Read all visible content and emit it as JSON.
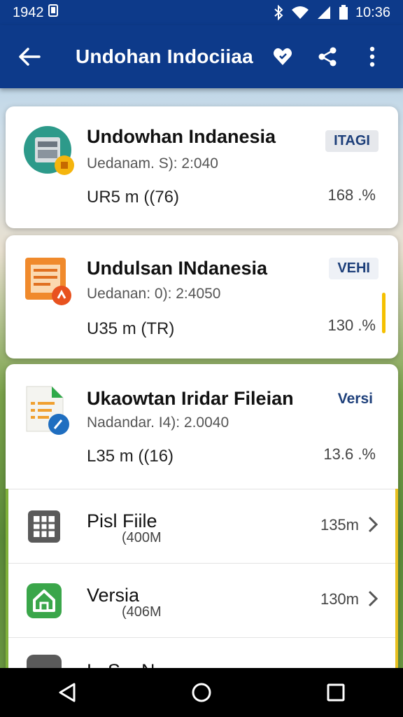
{
  "status_bar": {
    "time_left": "1942 ",
    "time_right": "10:36"
  },
  "app_bar": {
    "title": "Undohan Indociiaa"
  },
  "cards": [
    {
      "name": "Undowhan Indanesia",
      "subtitle": "Uedanam. S): 2:040",
      "size": "UR5 m ((76)",
      "badge": "ITAGI",
      "percent": "168 .%"
    },
    {
      "name": "Undulsan INdanesia",
      "subtitle": "Uedanan: 0): 2:4050",
      "size": "U35 m (TR)",
      "badge": "VEHI",
      "percent": "130 .%"
    },
    {
      "name": "Ukaowtan Iridar Fileian",
      "subtitle": "Nadandar. I4): 2.0040",
      "size": "L35 m ((16)",
      "badge": "Versi",
      "percent": "13.6 .%"
    }
  ],
  "rows": [
    {
      "name": "Pisl Fiile",
      "sub": "(400M",
      "value": "135m"
    },
    {
      "name": "Versia",
      "sub": "(406M",
      "value": "130m"
    },
    {
      "name": "L..S... N..."
    }
  ],
  "colors": {
    "primary": "#0d3a8a",
    "orange": "#f08a2c",
    "green": "#3aa64a",
    "blue_badge": "#1d3f7a"
  }
}
